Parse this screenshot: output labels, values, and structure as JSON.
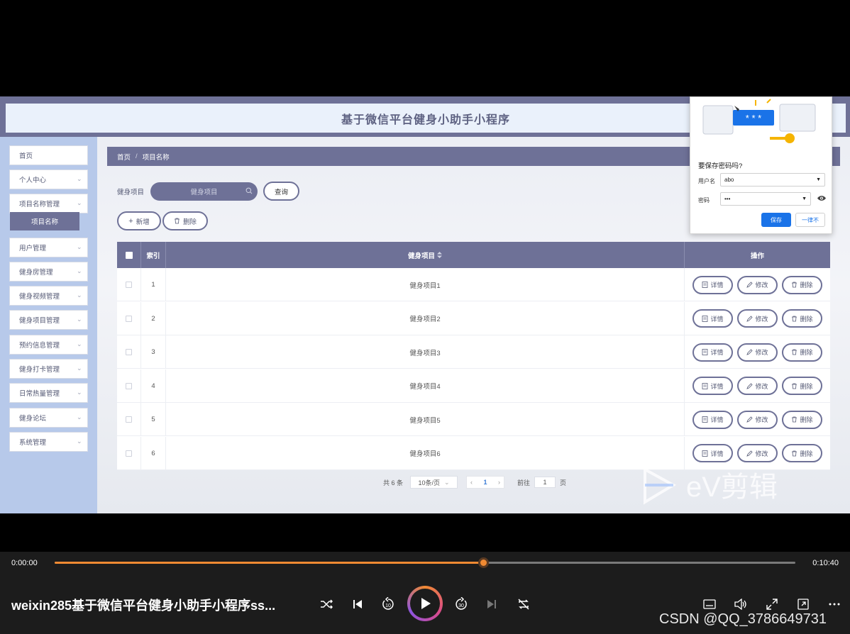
{
  "app": {
    "title": "基于微信平台健身小助手小程序"
  },
  "sidebar": {
    "items": [
      {
        "label": "首页",
        "chevron": false
      },
      {
        "label": "个人中心",
        "chevron": true
      },
      {
        "label": "项目名称管理",
        "chevron": true
      },
      {
        "label": "用户管理",
        "chevron": true
      },
      {
        "label": "健身房管理",
        "chevron": true
      },
      {
        "label": "健身视频管理",
        "chevron": true
      },
      {
        "label": "健身项目管理",
        "chevron": true
      },
      {
        "label": "预约信息管理",
        "chevron": true
      },
      {
        "label": "健身打卡管理",
        "chevron": true
      },
      {
        "label": "日常热量管理",
        "chevron": true
      },
      {
        "label": "健身论坛",
        "chevron": true
      },
      {
        "label": "系统管理",
        "chevron": true
      }
    ],
    "active_sub": "项目名称"
  },
  "breadcrumb": {
    "home": "首页",
    "separator": "/",
    "current": "项目名称"
  },
  "search": {
    "label": "健身项目",
    "placeholder": "健身项目",
    "query_label": "查询"
  },
  "actions": {
    "add_label": "新增",
    "delete_label": "删除"
  },
  "table": {
    "headers": {
      "index": "索引",
      "project": "健身项目",
      "ops": "操作"
    },
    "rows": [
      {
        "index": "1",
        "project": "健身项目1"
      },
      {
        "index": "2",
        "project": "健身项目2"
      },
      {
        "index": "3",
        "project": "健身项目3"
      },
      {
        "index": "4",
        "project": "健身项目4"
      },
      {
        "index": "5",
        "project": "健身项目5"
      },
      {
        "index": "6",
        "project": "健身项目6"
      }
    ],
    "op_labels": {
      "detail": "详情",
      "edit": "修改",
      "delete": "删除"
    }
  },
  "pagination": {
    "total": "共 6 条",
    "page_size": "10条/页",
    "current_page": "1",
    "goto_label": "前往",
    "goto_value": "1",
    "page_suffix": "页"
  },
  "password_popup": {
    "title": "要保存密码吗?",
    "username_label": "用户名",
    "username_value": "abo",
    "password_label": "密码",
    "password_value": "•••",
    "save_label": "保存",
    "never_label": "一律不",
    "illustration_text": "* * *"
  },
  "watermark": {
    "text": "eV剪辑"
  },
  "player": {
    "time_current": "0:00:00",
    "time_total": "0:10:40",
    "progress": 0.579,
    "video_title": "weixin285基于微信平台健身小助手小程序ss...",
    "rewind_label": "10",
    "forward_label": "30",
    "accent": "#f08a32"
  },
  "overlay": {
    "csdn": "CSDN @QQ_3786649731"
  },
  "colors": {
    "primary": "#6e7197",
    "sidebar_bg": "#b7c9ea",
    "header_inner": "#eaf1fb",
    "chrome_blue": "#1a73e8"
  }
}
